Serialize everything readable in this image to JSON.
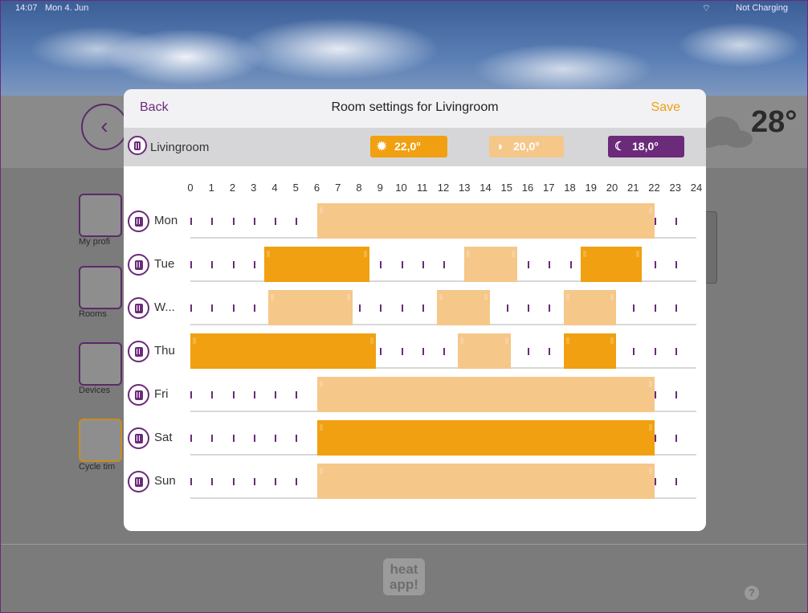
{
  "status_bar": {
    "time": "14:07",
    "date": "Mon 4. Jun",
    "charging": "Not Charging"
  },
  "background": {
    "temperature": "28°",
    "sidebar": [
      "My profi",
      "Rooms",
      "Devices",
      "Cycle tim"
    ],
    "logo": "heat app!",
    "help": "?"
  },
  "modal": {
    "back_label": "Back",
    "title": "Room settings for Livingroom",
    "save_label": "Save",
    "room_name": "Livingroom",
    "temps": {
      "comfort": "22,0°",
      "eco": "20,0°",
      "night": "18,0°"
    },
    "hours": [
      "0",
      "1",
      "2",
      "3",
      "4",
      "5",
      "6",
      "7",
      "8",
      "9",
      "10",
      "11",
      "12",
      "13",
      "14",
      "15",
      "16",
      "17",
      "18",
      "19",
      "20",
      "21",
      "22",
      "23",
      "24"
    ],
    "days": [
      {
        "label": "Mon",
        "blocks": [
          {
            "start": 6,
            "end": 22,
            "mode": "eco"
          }
        ]
      },
      {
        "label": "Tue",
        "blocks": [
          {
            "start": 3.5,
            "end": 8.5,
            "mode": "comfort"
          },
          {
            "start": 13,
            "end": 15.5,
            "mode": "eco"
          },
          {
            "start": 18.5,
            "end": 21.4,
            "mode": "comfort"
          }
        ]
      },
      {
        "label": "W...",
        "blocks": [
          {
            "start": 3.7,
            "end": 7.7,
            "mode": "eco"
          },
          {
            "start": 11.7,
            "end": 14.2,
            "mode": "eco"
          },
          {
            "start": 17.7,
            "end": 20.2,
            "mode": "eco"
          }
        ]
      },
      {
        "label": "Thu",
        "blocks": [
          {
            "start": 0,
            "end": 8.8,
            "mode": "comfort"
          },
          {
            "start": 12.7,
            "end": 15.2,
            "mode": "eco"
          },
          {
            "start": 17.7,
            "end": 20.2,
            "mode": "comfort"
          }
        ]
      },
      {
        "label": "Fri",
        "blocks": [
          {
            "start": 6,
            "end": 22,
            "mode": "eco"
          }
        ]
      },
      {
        "label": "Sat",
        "blocks": [
          {
            "start": 6,
            "end": 22,
            "mode": "comfort"
          }
        ]
      },
      {
        "label": "Sun",
        "blocks": [
          {
            "start": 6,
            "end": 22,
            "mode": "eco"
          }
        ]
      }
    ]
  },
  "colors": {
    "purple": "#6b2a7a",
    "comfort": "#f0a010",
    "eco": "#f5c789"
  }
}
